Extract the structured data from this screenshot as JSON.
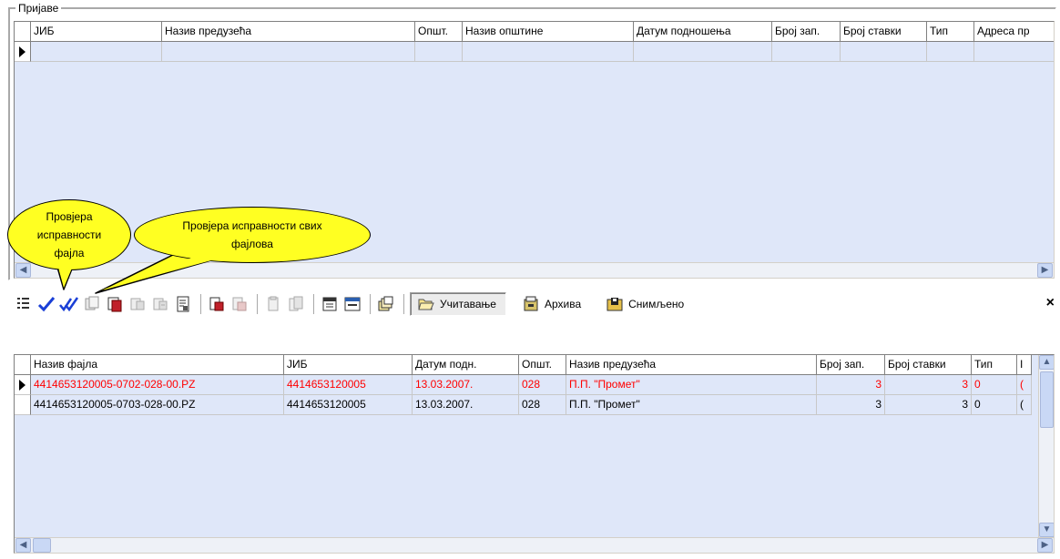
{
  "top_panel": {
    "group_title": "Пријаве",
    "columns": [
      {
        "label": "ЈИБ",
        "width": 144
      },
      {
        "label": "Назив предузећа",
        "width": 278
      },
      {
        "label": "Општ.",
        "width": 52
      },
      {
        "label": "Назив општине",
        "width": 188
      },
      {
        "label": "Датум подношења",
        "width": 152
      },
      {
        "label": "Број зап.",
        "width": 75
      },
      {
        "label": "Број ставки",
        "width": 95
      },
      {
        "label": "Тип",
        "width": 52
      },
      {
        "label": "Адреса пр",
        "width": 89
      }
    ]
  },
  "callouts": {
    "check_file": "Провјера исправности фајла",
    "check_all": "Провјера исправности свих фајлова"
  },
  "toolbar": {
    "icons": [
      "columns-icon",
      "check-icon",
      "check-all-icon",
      "copy-file-icon",
      "delete-file-icon",
      "export-icon",
      "export-all-icon",
      "report-icon",
      "import-icon",
      "import-all-icon",
      "paste-icon",
      "paste-all-icon",
      "calendar-icon",
      "calendar-range-icon",
      "stack-icon"
    ],
    "load_label": "Учитавање",
    "archive_label": "Архива",
    "saved_label": "Снимљено",
    "close_glyph": "×"
  },
  "bottom_panel": {
    "columns": [
      {
        "label": "Назив фајла",
        "width": 278
      },
      {
        "label": "ЈИБ",
        "width": 141
      },
      {
        "label": "Датум подн.",
        "width": 117
      },
      {
        "label": "Општ.",
        "width": 52
      },
      {
        "label": "Назив предузећа",
        "width": 275
      },
      {
        "label": "Број зап.",
        "width": 75
      },
      {
        "label": "Број ставки",
        "width": 95
      },
      {
        "label": "Тип",
        "width": 50
      },
      {
        "label": "I",
        "width": 16
      }
    ],
    "rows": [
      {
        "file": "4414653120005-0702-028-00.PZ",
        "jib": "4414653120005",
        "date": "13.03.2007.",
        "mun": "028",
        "company": "П.П. \"Промет\"",
        "records": "3",
        "items": "3",
        "type": "0",
        "extra": "(",
        "highlighted": true,
        "current": true
      },
      {
        "file": "4414653120005-0703-028-00.PZ",
        "jib": "4414653120005",
        "date": "13.03.2007.",
        "mun": "028",
        "company": "П.П. \"Промет\"",
        "records": "3",
        "items": "3",
        "type": "0",
        "extra": "(",
        "highlighted": false,
        "current": false
      }
    ]
  },
  "colors": {
    "grid_bg": "#dfe7f9",
    "error_text": "#ff0000",
    "callout_fill": "#ffff22",
    "check_blue": "#1a3fd6"
  }
}
